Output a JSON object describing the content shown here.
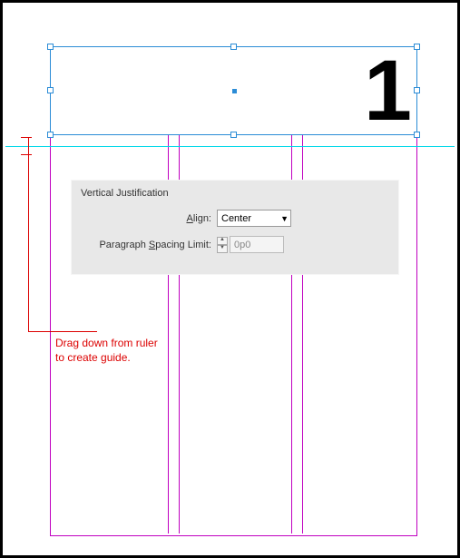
{
  "page": {
    "number": "1"
  },
  "panel": {
    "title": "Vertical Justification",
    "align_label_pre": "",
    "align_label_ul": "A",
    "align_label_post": "lign:",
    "align_value": "Center",
    "spacing_label_pre": "Paragraph ",
    "spacing_label_ul": "S",
    "spacing_label_post": "pacing Limit:",
    "spacing_value": "0p0"
  },
  "annotation": {
    "text": "Drag down from ruler\nto create guide."
  }
}
